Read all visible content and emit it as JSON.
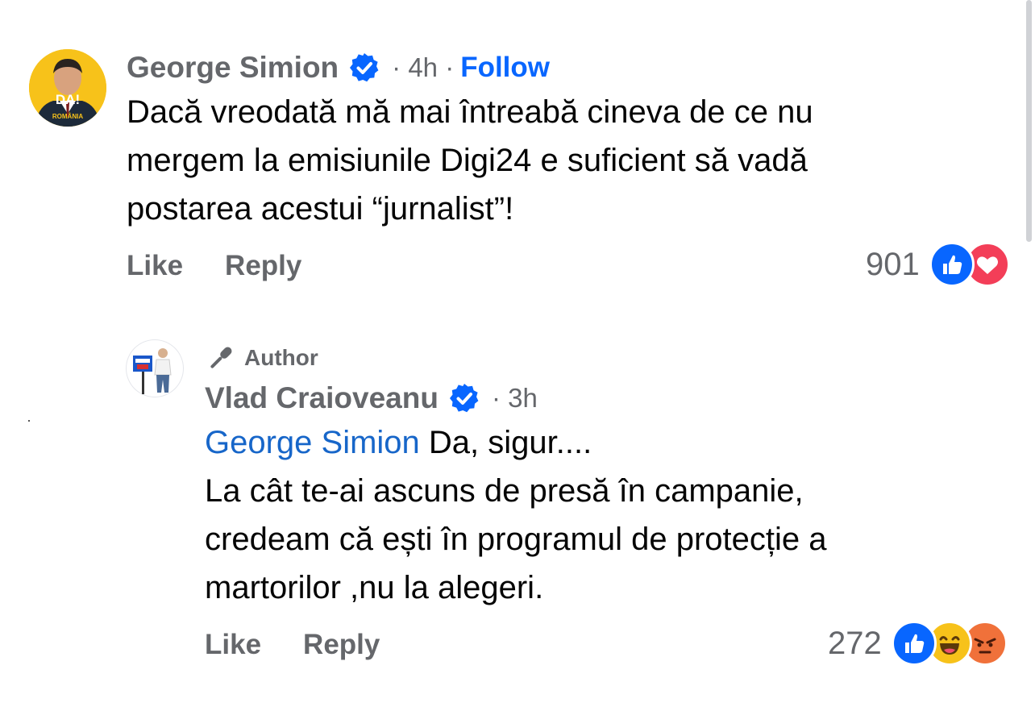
{
  "comment": {
    "author": "George Simion",
    "time": "· 4h ·",
    "follow_label": "Follow",
    "avatar_text": "DA!",
    "avatar_subtext": "ROMÂNIA",
    "text_lines": [
      "Dacă vreodată mă mai întreabă cineva de ce nu",
      "mergem la emisiunile Digi24 e suficient să vadă",
      "postarea acestui “jurnalist”!"
    ],
    "like_label": "Like",
    "reply_label": "Reply",
    "reaction_count": "901",
    "reaction_icons": [
      "like-icon",
      "love-icon"
    ]
  },
  "reply": {
    "badge_label": "Author",
    "author": "Vlad Craioveanu",
    "time": "· 3h",
    "mention": "George Simion",
    "first_line_rest": " Da, sigur....",
    "text_lines": [
      "La cât te-ai ascuns de presă în campanie,",
      "credeam că ești în programul de protecție a",
      "martorilor ,nu la alegeri."
    ],
    "like_label": "Like",
    "reply_label": "Reply",
    "reaction_count": "272",
    "reaction_icons": [
      "like-icon",
      "haha-icon",
      "angry-icon"
    ]
  },
  "colors": {
    "link_blue": "#0866ff",
    "mention_blue": "#1766c9",
    "meta_gray": "#65676b",
    "love_red": "#f33e58",
    "avatar_yellow": "#f7c21a"
  }
}
